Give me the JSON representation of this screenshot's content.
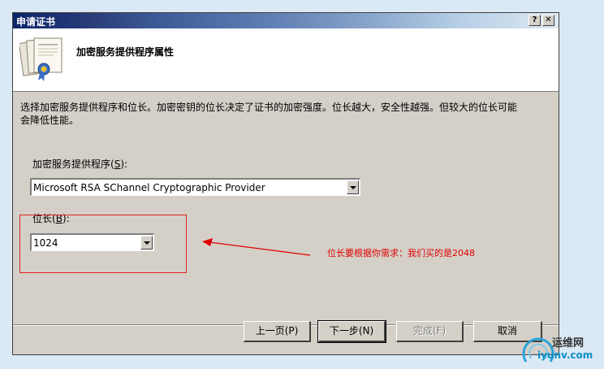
{
  "window": {
    "title": "申请证书",
    "help_label": "?",
    "close_label": "✕"
  },
  "header": {
    "title": "加密服务提供程序属性",
    "icon": "certificate-icon"
  },
  "content": {
    "description": "选择加密服务提供程序和位长。加密密钥的位长决定了证书的加密强度。位长越大，安全性越强。但较大的位长可能会降低性能。",
    "provider_label": "加密服务提供程序",
    "provider_hotkey": "S",
    "provider_value": "Microsoft RSA SChannel Cryptographic Provider",
    "bitlength_label": "位长",
    "bitlength_hotkey": "B",
    "bitlength_value": "1024"
  },
  "annotation": {
    "text": "位长要根据你需求：我们买的是2048",
    "color": "#e00000"
  },
  "buttons": {
    "back": "上一页(P)",
    "next": "下一步(N)",
    "finish": "完成(F)",
    "cancel": "取消"
  },
  "watermark": {
    "cn": "运维网",
    "en": "iyunv.com"
  }
}
